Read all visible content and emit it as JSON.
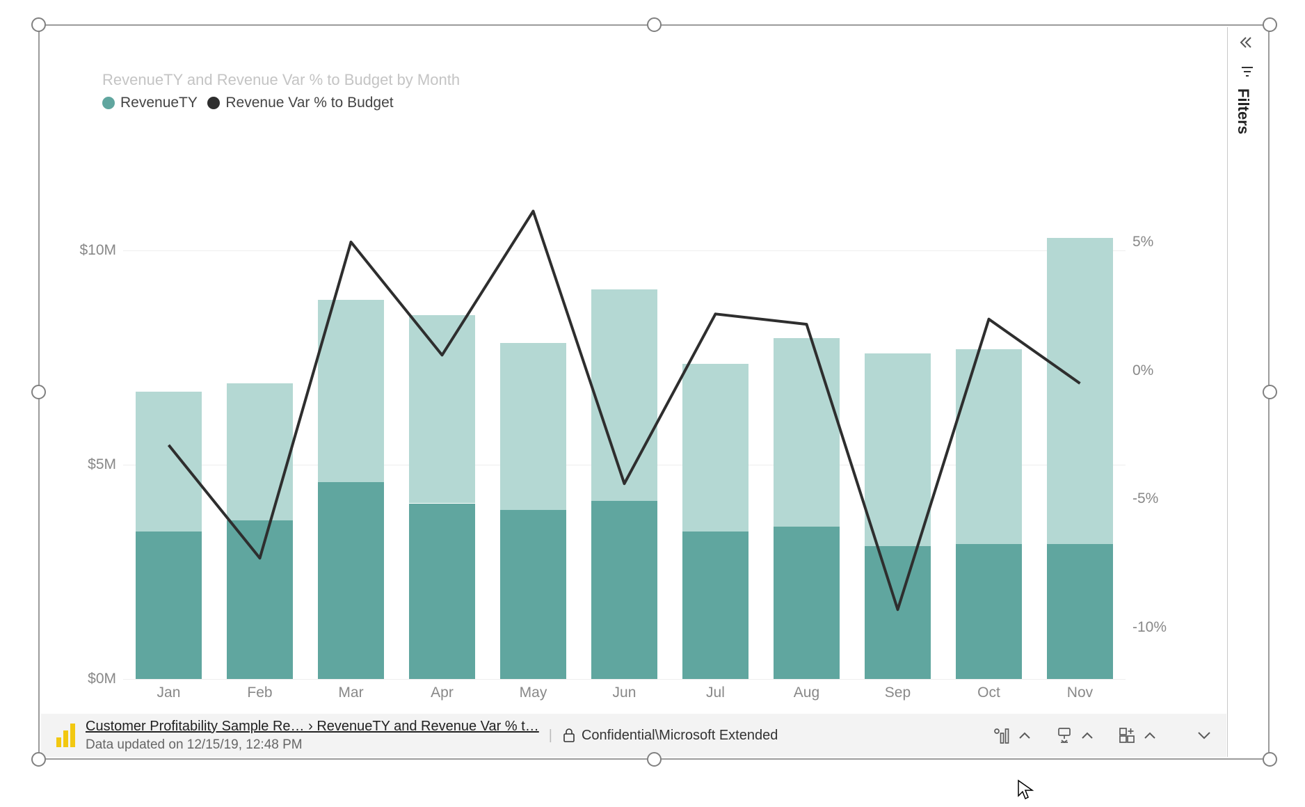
{
  "chart_data": {
    "type": "bar+line",
    "title": "RevenueTY and Revenue Var % to Budget by Month",
    "legend": [
      "RevenueTY",
      "Revenue Var % to Budget"
    ],
    "categories": [
      "Jan",
      "Feb",
      "Mar",
      "Apr",
      "May",
      "Jun",
      "Jul",
      "Aug",
      "Sep",
      "Oct",
      "Nov"
    ],
    "series": [
      {
        "name": "RevenueTY_lower",
        "type": "bar-stack",
        "values": [
          3.45,
          3.7,
          4.6,
          4.1,
          3.95,
          4.15,
          3.45,
          3.55,
          3.1,
          3.15,
          3.15
        ]
      },
      {
        "name": "RevenueTY_total",
        "type": "bar-stack",
        "values": [
          6.7,
          6.9,
          8.85,
          8.5,
          7.85,
          9.1,
          7.35,
          7.95,
          7.6,
          7.7,
          10.3
        ]
      },
      {
        "name": "Revenue Var % to Budget",
        "type": "line",
        "values": [
          -2.9,
          -7.3,
          5.0,
          0.6,
          6.2,
          -4.4,
          2.2,
          1.8,
          -9.3,
          2.0,
          -0.5
        ]
      }
    ],
    "y_left": {
      "min": 0,
      "max": 12,
      "ticks": [
        0,
        5,
        10
      ],
      "tick_labels": [
        "$0M",
        "$5M",
        "$10M"
      ],
      "label": ""
    },
    "y_right": {
      "min": -12,
      "max": 8,
      "ticks": [
        -10,
        -5,
        0,
        5
      ],
      "tick_labels": [
        "-10%",
        "-5%",
        "0%",
        "5%"
      ],
      "label": ""
    },
    "bar_colors": {
      "lower": "#60a69f",
      "upper": "#b4d8d3"
    },
    "line_color": "#2e2e2e"
  },
  "filters_pane": {
    "label": "Filters"
  },
  "footer": {
    "breadcrumb": "Customer Profitability Sample Re… › RevenueTY and Revenue Var % t…",
    "updated": "Data updated on 12/15/19, 12:48 PM",
    "confidential": "Confidential\\Microsoft Extended"
  }
}
